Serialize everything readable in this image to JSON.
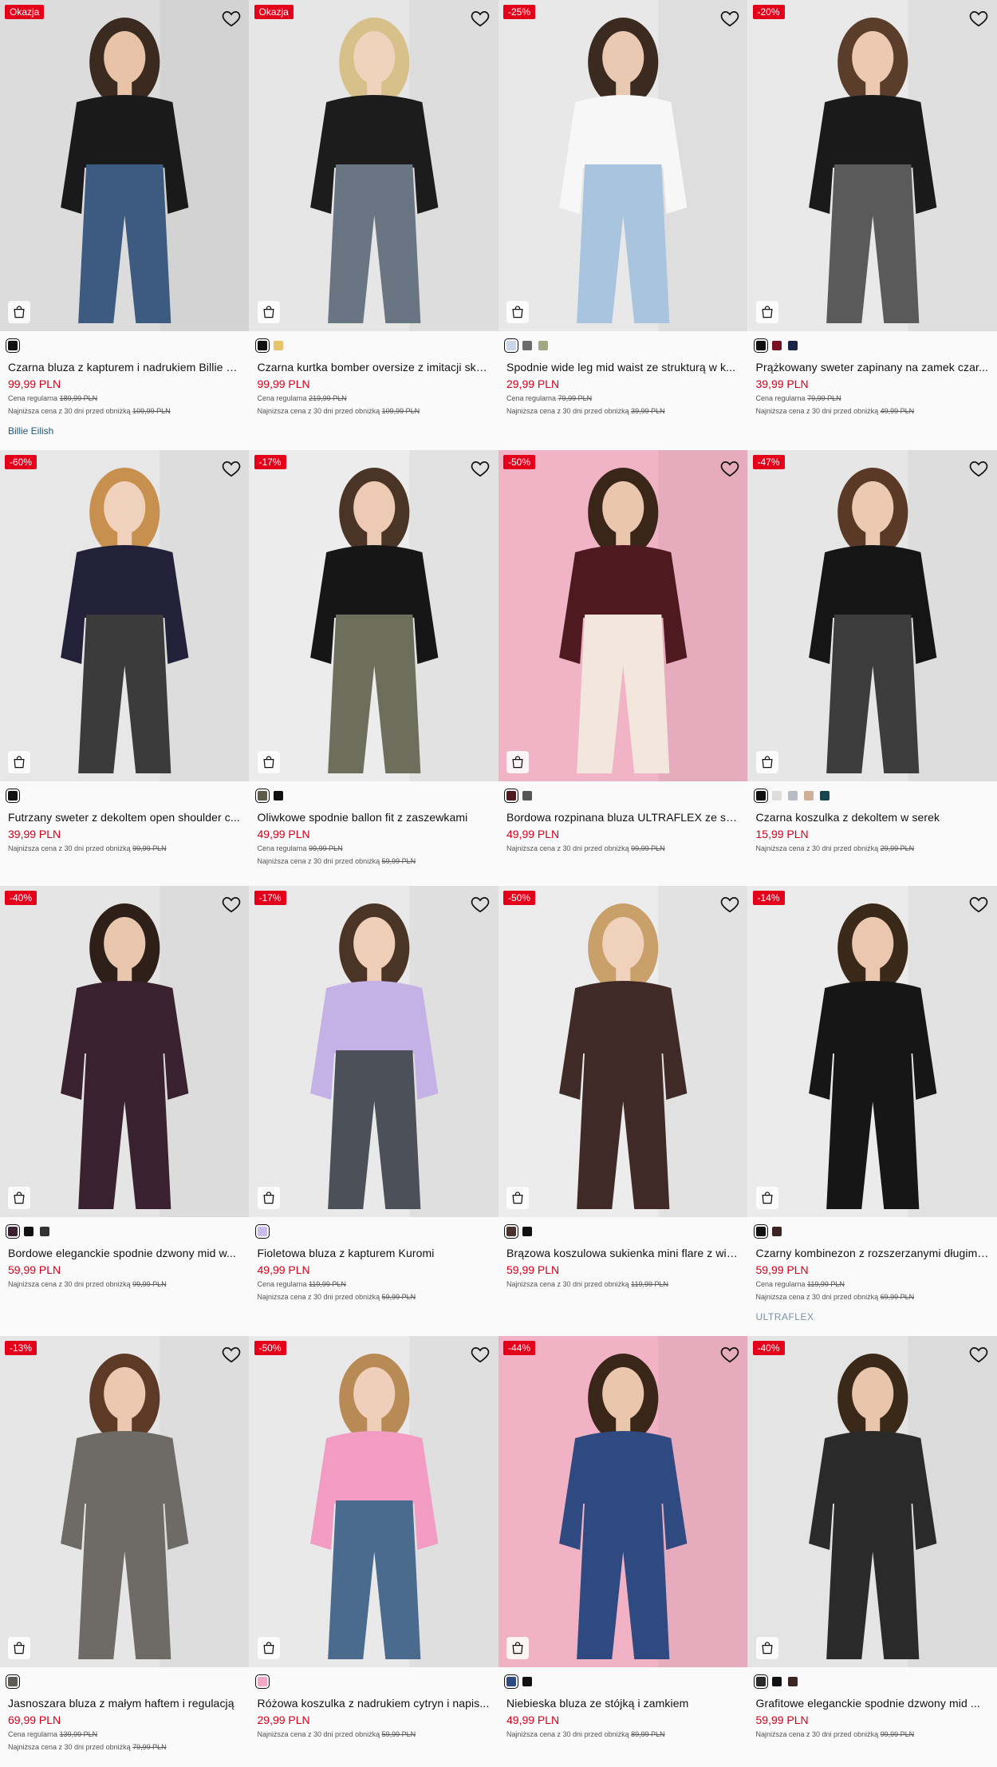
{
  "products": [
    {
      "badge": "Okazja",
      "bg": "#dcdcdc",
      "top": "#1a1a1a",
      "bottom": "#3d5a80",
      "skin": "#e8c3a8",
      "hair": "#3a2a20",
      "swatches": [
        {
          "color": "#111111",
          "selected": true
        }
      ],
      "name": "Czarna bluza z kapturem i nadrukiem Billie E...",
      "price": "99,99 PLN",
      "regular_label": "Cena regularna",
      "regular_price": "189,99 PLN",
      "lowest_label": "Najniższa cena z 30 dni przed obniżką",
      "lowest_price": "109,99 PLN",
      "tag": "Billie Eilish",
      "tag_style": "blue"
    },
    {
      "badge": "Okazja",
      "bg": "#e6e6e6",
      "top": "#1c1c1c",
      "bottom": "#6a7583",
      "skin": "#f0d2bd",
      "hair": "#d8c08a",
      "swatches": [
        {
          "color": "#111111",
          "selected": true
        },
        {
          "color": "#e8c46a",
          "selected": false
        }
      ],
      "name": "Czarna kurtka bomber oversize z imitacji skó...",
      "price": "99,99 PLN",
      "regular_label": "Cena regularna",
      "regular_price": "219,99 PLN",
      "lowest_label": "Najniższa cena z 30 dni przed obniżką",
      "lowest_price": "109,99 PLN",
      "tag": ""
    },
    {
      "badge": "-25%",
      "bg": "#e8e8e8",
      "top": "#f7f7f7",
      "bottom": "#a9c4de",
      "skin": "#eac9b3",
      "hair": "#3a2a20",
      "swatches": [
        {
          "color": "#c8d6e6",
          "selected": true
        },
        {
          "color": "#6b6b6b",
          "selected": false
        },
        {
          "color": "#a3a884",
          "selected": false
        }
      ],
      "name": "Spodnie wide leg mid waist ze strukturą w k...",
      "price": "29,99 PLN",
      "regular_label": "Cena regularna",
      "regular_price": "79,99 PLN",
      "lowest_label": "Najniższa cena z 30 dni przed obniżką",
      "lowest_price": "39,99 PLN",
      "tag": ""
    },
    {
      "badge": "-20%",
      "bg": "#e9e9e9",
      "top": "#1a1a1a",
      "bottom": "#5a5a5a",
      "skin": "#ecc9b0",
      "hair": "#5a3e2b",
      "swatches": [
        {
          "color": "#111111",
          "selected": true
        },
        {
          "color": "#7a1024",
          "selected": false
        },
        {
          "color": "#1c2448",
          "selected": false
        }
      ],
      "name": "Prążkowany sweter zapinany na zamek czar...",
      "price": "39,99 PLN",
      "regular_label": "Cena regularna",
      "regular_price": "79,99 PLN",
      "lowest_label": "Najniższa cena z 30 dni przed obniżką",
      "lowest_price": "49,99 PLN",
      "tag": ""
    },
    {
      "badge": "-60%",
      "bg": "#e7e7e7",
      "top": "#23213a",
      "bottom": "#3b3b3b",
      "skin": "#f0d1bb",
      "hair": "#c8904f",
      "swatches": [
        {
          "color": "#111111",
          "selected": true
        }
      ],
      "name": "Futrzany sweter z dekoltem open shoulder c...",
      "price": "39,99 PLN",
      "regular_label": "",
      "regular_price": "",
      "lowest_label": "Najniższa cena z 30 dni przed obniżką",
      "lowest_price": "99,99 PLN",
      "tag": ""
    },
    {
      "badge": "-17%",
      "bg": "#ececec",
      "top": "#161616",
      "bottom": "#6e6e5c",
      "skin": "#eccab4",
      "hair": "#4a3426",
      "swatches": [
        {
          "color": "#5c5c48",
          "selected": true
        },
        {
          "color": "#111111",
          "selected": false
        }
      ],
      "name": "Oliwkowe spodnie ballon fit z zaszewkami",
      "price": "49,99 PLN",
      "regular_label": "Cena regularna",
      "regular_price": "99,99 PLN",
      "lowest_label": "Najniższa cena z 30 dni przed obniżką",
      "lowest_price": "59,99 PLN",
      "tag": ""
    },
    {
      "badge": "-50%",
      "bg": "#f0b4c6",
      "top": "#4e1a20",
      "bottom": "#f3e6dc",
      "skin": "#eac6ad",
      "hair": "#3a2618",
      "swatches": [
        {
          "color": "#4e1a20",
          "selected": true
        },
        {
          "color": "#555555",
          "selected": false
        }
      ],
      "name": "Bordowa rozpinana bluza ULTRAFLEX ze stój...",
      "price": "49,99 PLN",
      "regular_label": "",
      "regular_price": "",
      "lowest_label": "Najniższa cena z 30 dni przed obniżką",
      "lowest_price": "99,99 PLN",
      "tag": ""
    },
    {
      "badge": "-47%",
      "bg": "#e6e6e6",
      "top": "#151515",
      "bottom": "#3c3c3c",
      "skin": "#ecc9b1",
      "hair": "#5a3a26",
      "swatches": [
        {
          "color": "#111111",
          "selected": true
        },
        {
          "color": "#dddddd",
          "selected": false
        },
        {
          "color": "#b8bcc4",
          "selected": false
        },
        {
          "color": "#cfb096",
          "selected": false
        },
        {
          "color": "#174650",
          "selected": false
        }
      ],
      "name": "Czarna koszulka z dekoltem w serek",
      "price": "15,99 PLN",
      "regular_label": "",
      "regular_price": "",
      "lowest_label": "Najniższa cena z 30 dni przed obniżką",
      "lowest_price": "29,99 PLN",
      "tag": ""
    },
    {
      "badge": "-40%",
      "bg": "#e5e5e5",
      "top": "#3a2130",
      "bottom": "#3a2130",
      "skin": "#e9c6ae",
      "hair": "#2e1f18",
      "swatches": [
        {
          "color": "#3a2130",
          "selected": true
        },
        {
          "color": "#111111",
          "selected": false
        },
        {
          "color": "#333333",
          "selected": false
        }
      ],
      "name": "Bordowe eleganckie spodnie dzwony mid w...",
      "price": "59,99 PLN",
      "regular_label": "",
      "regular_price": "",
      "lowest_label": "Najniższa cena z 30 dni przed obniżką",
      "lowest_price": "99,99 PLN",
      "tag": ""
    },
    {
      "badge": "-17%",
      "bg": "#e9e9e9",
      "top": "#c4b2e6",
      "bottom": "#4c5058",
      "skin": "#f0cfb8",
      "hair": "#4a3426",
      "swatches": [
        {
          "color": "#c9bce8",
          "selected": true
        }
      ],
      "name": "Fioletowa bluza z kapturem Kuromi",
      "price": "49,99 PLN",
      "regular_label": "Cena regularna",
      "regular_price": "119,99 PLN",
      "lowest_label": "Najniższa cena z 30 dni przed obniżką",
      "lowest_price": "59,99 PLN",
      "tag": ""
    },
    {
      "badge": "-50%",
      "bg": "#ececec",
      "top": "#3f2a28",
      "bottom": "#3f2a28",
      "skin": "#f0d2bc",
      "hair": "#caa06a",
      "swatches": [
        {
          "color": "#4a3230",
          "selected": true
        },
        {
          "color": "#111111",
          "selected": false
        }
      ],
      "name": "Brązowa koszulowa sukienka mini flare z wią...",
      "price": "59,99 PLN",
      "regular_label": "",
      "regular_price": "",
      "lowest_label": "Najniższa cena z 30 dni przed obniżką",
      "lowest_price": "119,99 PLN",
      "tag": ""
    },
    {
      "badge": "-14%",
      "bg": "#ebebeb",
      "top": "#161616",
      "bottom": "#161616",
      "skin": "#eac7ae",
      "hair": "#3a2818",
      "swatches": [
        {
          "color": "#111111",
          "selected": true
        },
        {
          "color": "#3a2522",
          "selected": false
        }
      ],
      "name": "Czarny kombinezon z rozszerzanymi długimi...",
      "price": "59,99 PLN",
      "regular_label": "Cena regularna",
      "regular_price": "119,99 PLN",
      "lowest_label": "Najniższa cena z 30 dni przed obniżką",
      "lowest_price": "69,99 PLN",
      "tag": "ULTRAFLEX",
      "tag_style": "grey"
    },
    {
      "badge": "-13%",
      "bg": "#e6e6e6",
      "top": "#6e6a66",
      "bottom": "#6e6a66",
      "skin": "#ebc8b0",
      "hair": "#5c3a26",
      "swatches": [
        {
          "color": "#5e5a56",
          "selected": true
        }
      ],
      "name": "Jasnoszara bluza z małym haftem i regulacją",
      "price": "69,99 PLN",
      "regular_label": "Cena regularna",
      "regular_price": "139,99 PLN",
      "lowest_label": "Najniższa cena z 30 dni przed obniżką",
      "lowest_price": "79,99 PLN",
      "tag": ""
    },
    {
      "badge": "-50%",
      "bg": "#e9e9e9",
      "top": "#f29cc4",
      "bottom": "#4a6a8e",
      "skin": "#efcfb9",
      "hair": "#b88a56",
      "swatches": [
        {
          "color": "#f2a6c6",
          "selected": true
        }
      ],
      "name": "Różowa koszulka z nadrukiem cytryn i napis...",
      "price": "29,99 PLN",
      "regular_label": "",
      "regular_price": "",
      "lowest_label": "Najniższa cena z 30 dni przed obniżką",
      "lowest_price": "59,99 PLN",
      "tag": ""
    },
    {
      "badge": "-44%",
      "bg": "#f0b2c4",
      "top": "#2f4a80",
      "bottom": "#2f4a80",
      "skin": "#eac6ad",
      "hair": "#3a2618",
      "swatches": [
        {
          "color": "#2f4a80",
          "selected": true
        },
        {
          "color": "#111111",
          "selected": false
        }
      ],
      "name": "Niebieska bluza ze stójką i zamkiem",
      "price": "49,99 PLN",
      "regular_label": "",
      "regular_price": "",
      "lowest_label": "Najniższa cena z 30 dni przed obniżką",
      "lowest_price": "89,99 PLN",
      "tag": ""
    },
    {
      "badge": "-40%",
      "bg": "#e4e4e4",
      "top": "#2a2a2a",
      "bottom": "#2a2a2a",
      "skin": "#e9c5ac",
      "hair": "#3a2818",
      "swatches": [
        {
          "color": "#2a2a2a",
          "selected": true
        },
        {
          "color": "#111111",
          "selected": false
        },
        {
          "color": "#3a2522",
          "selected": false
        }
      ],
      "name": "Grafitowe eleganckie spodnie dzwony mid ...",
      "price": "59,99 PLN",
      "regular_label": "",
      "regular_price": "",
      "lowest_label": "Najniższa cena z 30 dni przed obniżką",
      "lowest_price": "99,99 PLN",
      "tag": ""
    }
  ]
}
